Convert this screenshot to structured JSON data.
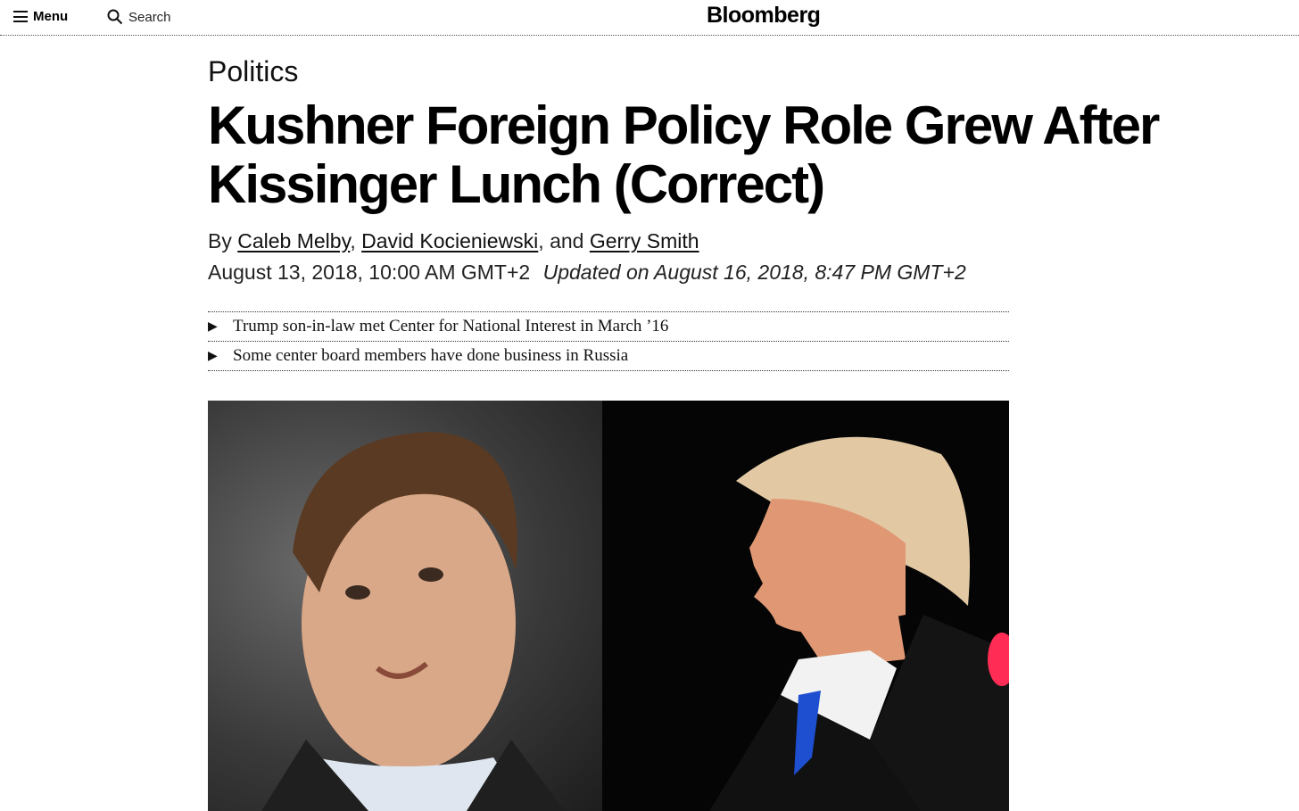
{
  "header": {
    "menu_label": "Menu",
    "search_label": "Search",
    "logo": "Bloomberg"
  },
  "article": {
    "kicker": "Politics",
    "headline": "Kushner Foreign Policy Role Grew After Kissinger Lunch (Correct)",
    "byline": {
      "prefix": "By ",
      "authors": [
        "Caleb Melby",
        "David Kocieniewski",
        "Gerry Smith"
      ],
      "sep1": ", ",
      "sep2": ", and "
    },
    "published": "August 13, 2018, 10:00 AM GMT+2",
    "updated": "Updated on August 16, 2018, 8:47 PM GMT+2",
    "bullets": [
      "Trump son-in-law met Center for National Interest in March ’16",
      "Some center board members have done business in Russia"
    ]
  },
  "icons": {
    "menu": "hamburger-icon",
    "search": "search-icon",
    "bullet": "play-triangle-icon"
  }
}
